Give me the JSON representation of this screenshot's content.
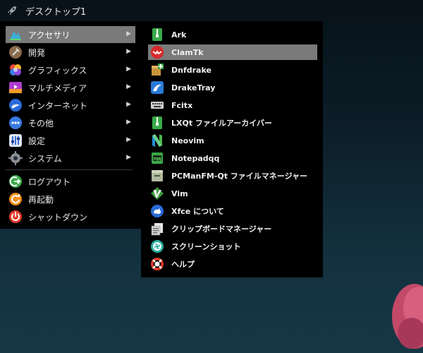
{
  "topbar": {
    "title": "デスクトップ1",
    "icon": "rocket-icon"
  },
  "main_menu": {
    "items": [
      {
        "label": "アクセサリ",
        "icon": "accessories-icon",
        "submenu": true,
        "active": true
      },
      {
        "label": "開発",
        "icon": "development-icon",
        "submenu": true
      },
      {
        "label": "グラフィックス",
        "icon": "graphics-icon",
        "submenu": true
      },
      {
        "label": "マルチメディア",
        "icon": "multimedia-icon",
        "submenu": true
      },
      {
        "label": "インターネット",
        "icon": "internet-icon",
        "submenu": true
      },
      {
        "label": "その他",
        "icon": "other-icon",
        "submenu": true
      },
      {
        "label": "設定",
        "icon": "settings-icon",
        "submenu": true
      },
      {
        "label": "システム",
        "icon": "system-icon",
        "submenu": true
      },
      {
        "label": "ログアウト",
        "icon": "logout-icon"
      },
      {
        "label": "再起動",
        "icon": "reboot-icon"
      },
      {
        "label": "シャットダウン",
        "icon": "shutdown-icon"
      }
    ],
    "arrow": "▶"
  },
  "sub_menu": {
    "items": [
      {
        "label": "Ark",
        "icon": "ark-icon"
      },
      {
        "label": "ClamTk",
        "icon": "clamtk-icon",
        "active": true
      },
      {
        "label": "Dnfdrake",
        "icon": "dnfdrake-icon"
      },
      {
        "label": "DrakeTray",
        "icon": "draketray-icon"
      },
      {
        "label": "Fcitx",
        "icon": "fcitx-keyboard-icon"
      },
      {
        "label": "LXQt ファイルアーカイバー",
        "icon": "archiver-icon"
      },
      {
        "label": "Neovim",
        "icon": "neovim-icon"
      },
      {
        "label": "Notepadqq",
        "icon": "notepadqq-icon"
      },
      {
        "label": "PCManFM-Qt ファイルマネージャー",
        "icon": "file-manager-icon"
      },
      {
        "label": "Vim",
        "icon": "vim-icon"
      },
      {
        "label": "Xfce について",
        "icon": "xfce-icon"
      },
      {
        "label": "クリップボードマネージャー",
        "icon": "clipboard-icon"
      },
      {
        "label": "スクリーンショット",
        "icon": "screenshot-icon"
      },
      {
        "label": "ヘルプ",
        "icon": "help-icon"
      }
    ]
  },
  "colors": {
    "highlight": "#7a7a7a",
    "menu_bg": "#000000",
    "desktop": "#12303c"
  }
}
